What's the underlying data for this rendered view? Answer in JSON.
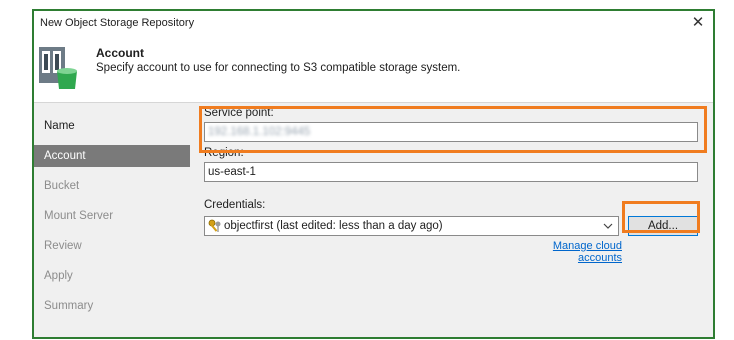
{
  "window": {
    "title": "New Object Storage Repository",
    "close_glyph": "✕"
  },
  "header": {
    "title": "Account",
    "subtitle": "Specify account to use for connecting to S3 compatible storage system.",
    "icon": "object-storage-repository-icon"
  },
  "sidebar": {
    "items": [
      {
        "label": "Name",
        "state": "done"
      },
      {
        "label": "Account",
        "state": "active"
      },
      {
        "label": "Bucket",
        "state": "pending"
      },
      {
        "label": "Mount Server",
        "state": "pending"
      },
      {
        "label": "Review",
        "state": "pending"
      },
      {
        "label": "Apply",
        "state": "pending"
      },
      {
        "label": "Summary",
        "state": "pending"
      }
    ]
  },
  "form": {
    "service_point": {
      "label": "Service point:",
      "value": "192.168.1.102:9445"
    },
    "region": {
      "label": "Region:",
      "value": "us-east-1"
    },
    "credentials": {
      "label": "Credentials:",
      "selected": "objectfirst (last edited: less than a day ago)",
      "icon": "key-icon"
    },
    "add_button": "Add...",
    "manage_link": "Manage cloud accounts"
  },
  "colors": {
    "highlight": "#f07c1f",
    "frame": "#2e7d32",
    "link": "#0066cc",
    "active_nav": "#7a7a7a"
  }
}
